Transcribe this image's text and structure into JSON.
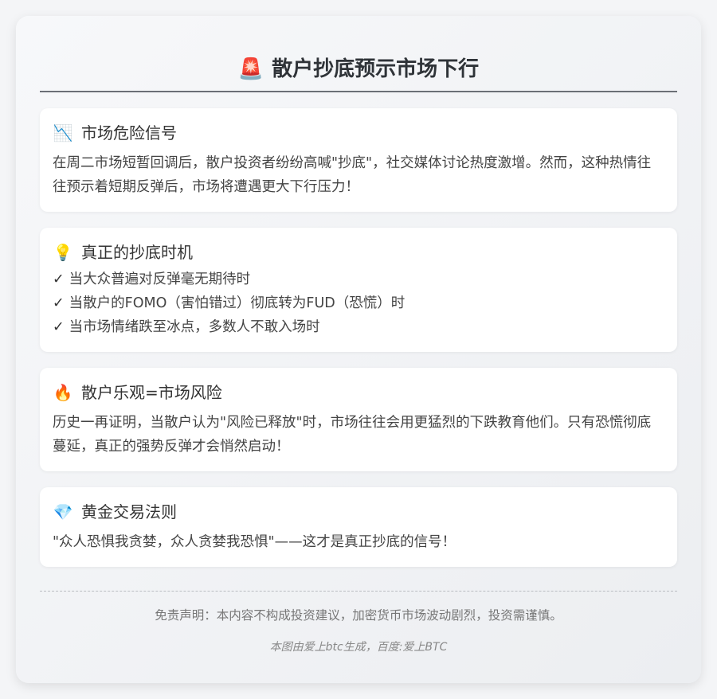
{
  "header": {
    "icon": "🚨",
    "title": "散户抄底预示市场下行"
  },
  "sections": [
    {
      "icon": "📉",
      "title": "市场危险信号",
      "body": "在周二市场短暂回调后，散户投资者纷纷高喊\"抄底\"，社交媒体讨论热度激增。然而，这种热情往往预示着短期反弹后，市场将遭遇更大下行压力！"
    },
    {
      "icon": "💡",
      "title": "真正的抄底时机",
      "items": [
        "当大众普遍对反弹毫无期待时",
        "当散户的FOMO（害怕错过）彻底转为FUD（恐慌）时",
        "当市场情绪跌至冰点，多数人不敢入场时"
      ]
    },
    {
      "icon": "🔥",
      "title": "散户乐观=市场风险",
      "body": "历史一再证明，当散户认为\"风险已释放\"时，市场往往会用更猛烈的下跌教育他们。只有恐慌彻底蔓延，真正的强势反弹才会悄然启动！"
    },
    {
      "icon": "💎",
      "title": "黄金交易法则",
      "body": "\"众人恐惧我贪婪，众人贪婪我恐惧\"——这才是真正抄底的信号！"
    }
  ],
  "check_mark": "✓",
  "footer": {
    "disclaimer": "免责声明：本内容不构成投资建议，加密货币市场波动剧烈，投资需谨慎。",
    "credit": "本图由爱上btc生成，百度:爱上BTC"
  }
}
